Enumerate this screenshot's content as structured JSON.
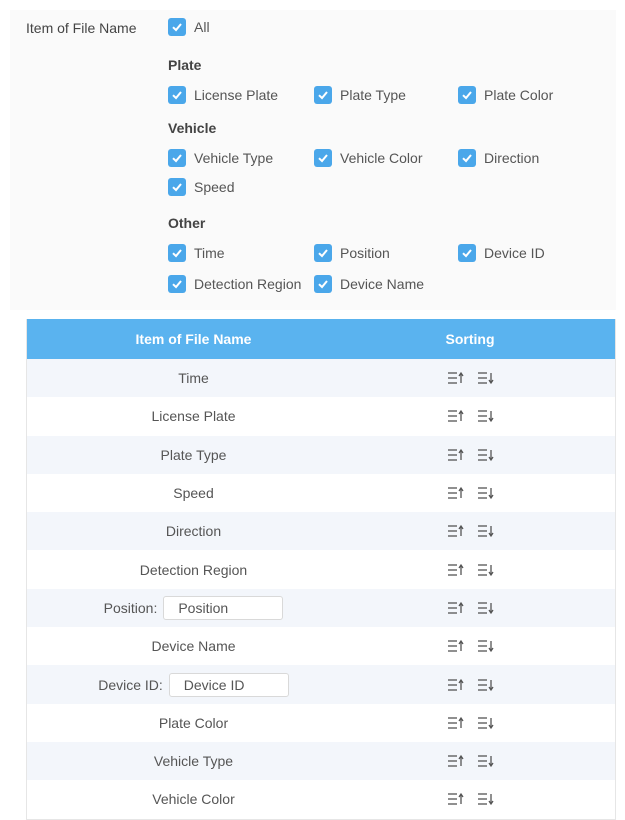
{
  "form": {
    "label": "Item of File Name",
    "all": "All",
    "groups": [
      {
        "title": "Plate",
        "items": [
          "License Plate",
          "Plate Type",
          "Plate Color"
        ]
      },
      {
        "title": "Vehicle",
        "items": [
          "Vehicle Type",
          "Vehicle Color",
          "Direction",
          "Speed"
        ]
      },
      {
        "title": "Other",
        "items": [
          "Time",
          "Position",
          "Device ID",
          "Detection Region",
          "Device Name"
        ]
      }
    ]
  },
  "table": {
    "headers": {
      "name": "Item of File Name",
      "sorting": "Sorting"
    },
    "rows": [
      {
        "name": "Time"
      },
      {
        "name": "License Plate"
      },
      {
        "name": "Plate Type"
      },
      {
        "name": "Speed"
      },
      {
        "name": "Direction"
      },
      {
        "name": "Detection Region"
      },
      {
        "name": "Position:",
        "input": "Position"
      },
      {
        "name": "Device Name"
      },
      {
        "name": "Device ID:",
        "input": "Device ID"
      },
      {
        "name": "Plate Color"
      },
      {
        "name": "Vehicle Type"
      },
      {
        "name": "Vehicle Color"
      }
    ]
  },
  "colors": {
    "accent": "#4aa7ea",
    "header": "#5ab3ef",
    "stripe": "#f3f6fb"
  },
  "icons": {
    "checkbox": "check-icon",
    "sort_up": "sort-ascending-icon",
    "sort_down": "sort-descending-icon"
  }
}
